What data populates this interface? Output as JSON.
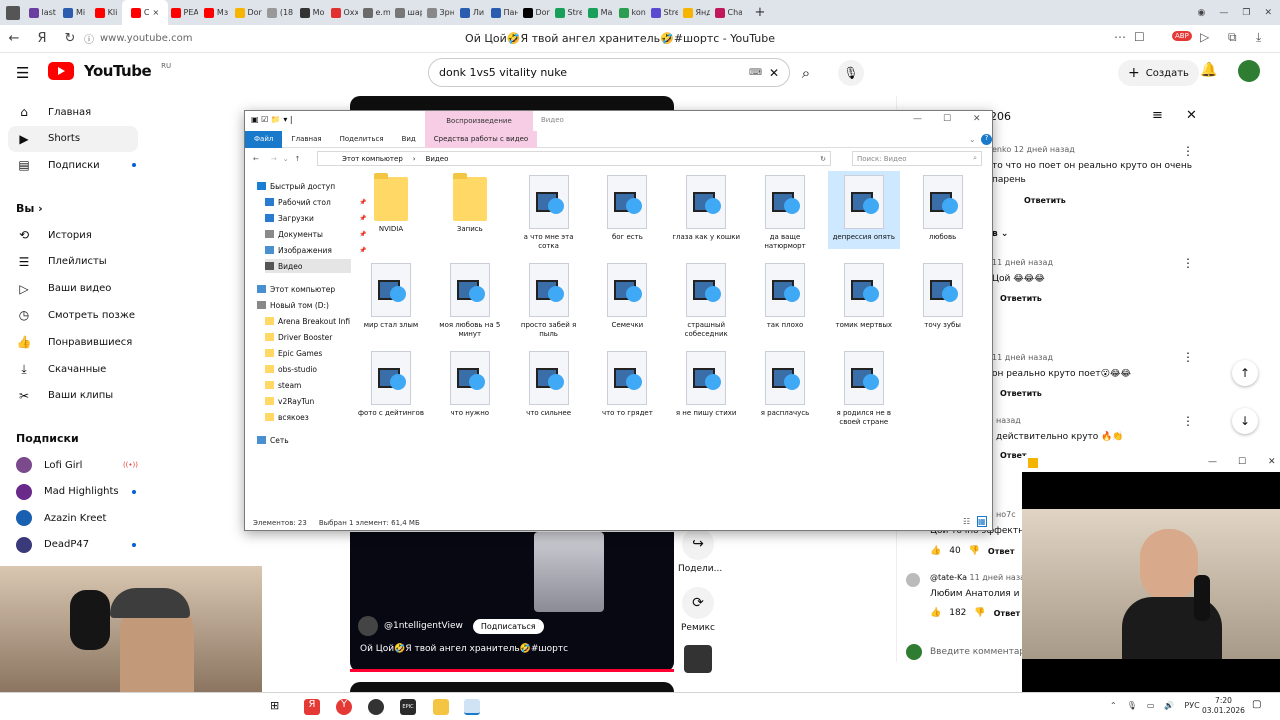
{
  "browser": {
    "tabs": [
      {
        "label": "last",
        "color": "#6b3fa0"
      },
      {
        "label": "Mi",
        "color": "#2a5db0"
      },
      {
        "label": "Kli",
        "color": "#ff0000"
      },
      {
        "label": "C",
        "color": "#ff0000",
        "active": true
      },
      {
        "label": "PEA",
        "color": "#ff0000"
      },
      {
        "label": "Mз",
        "color": "#ff0000"
      },
      {
        "label": "Dor",
        "color": "#f4b400"
      },
      {
        "label": "(18",
        "color": "#999999"
      },
      {
        "label": "Mo",
        "color": "#333333"
      },
      {
        "label": "Oxx",
        "color": "#e03030"
      },
      {
        "label": "e.m",
        "color": "#6a6a6a"
      },
      {
        "label": "шар",
        "color": "#777777"
      },
      {
        "label": "Зрн",
        "color": "#888888"
      },
      {
        "label": "Ли",
        "color": "#2a5db0"
      },
      {
        "label": "Пан",
        "color": "#2a5db0"
      },
      {
        "label": "Dor",
        "color": "#000000"
      },
      {
        "label": "Stre",
        "color": "#18a05a"
      },
      {
        "label": "Ma",
        "color": "#18a05a"
      },
      {
        "label": "kon",
        "color": "#2a9d50"
      },
      {
        "label": "Stre",
        "color": "#5a4ad0"
      },
      {
        "label": "Янд",
        "color": "#f4b400"
      },
      {
        "label": "Cha",
        "color": "#c2185b"
      }
    ],
    "url": "www.youtube.com",
    "page_title": "Ой Цой🤣Я твой ангел хранитель🤣#шортс - YouTube",
    "abp_label": "ABP"
  },
  "youtube": {
    "logo_text": "YouTube",
    "logo_region": "RU",
    "search_value": "donk 1vs5 vitality nuke",
    "create_label": "Создать",
    "nav": [
      {
        "label": "Главная",
        "icon": "home-icon"
      },
      {
        "label": "Shorts",
        "icon": "shorts-icon",
        "selected": true
      },
      {
        "label": "Подписки",
        "icon": "subscriptions-icon",
        "dot": true
      }
    ],
    "you_label": "Вы",
    "you_items": [
      {
        "label": "История",
        "icon": "history-icon"
      },
      {
        "label": "Плейлисты",
        "icon": "playlists-icon"
      },
      {
        "label": "Ваши видео",
        "icon": "your-videos-icon"
      },
      {
        "label": "Смотреть позже",
        "icon": "watch-later-icon"
      },
      {
        "label": "Понравившиеся",
        "icon": "liked-icon"
      },
      {
        "label": "Скачанные",
        "icon": "download-icon"
      },
      {
        "label": "Ваши клипы",
        "icon": "clips-icon"
      }
    ],
    "subs_heading": "Подписки",
    "channels": [
      {
        "label": "Lofi Girl",
        "color": "#7b4a8c",
        "live": true
      },
      {
        "label": "Mad Highlights",
        "color": "#6a2a8a",
        "dot": true
      },
      {
        "label": "Azazin Kreet",
        "color": "#1a60b0"
      },
      {
        "label": "DeadP47",
        "color": "#3a3a7a",
        "dot": true
      }
    ],
    "short": {
      "channel": "@1ntelligentView",
      "subscribe_label": "Подписаться",
      "title": "Ой Цой🤣Я твой ангел хранитель🤣#шортс",
      "share_label": "Подели...",
      "remix_label": "Ремикс"
    },
    "comments": {
      "count_partial": "206",
      "items": [
        {
          "author": "enko",
          "time": "12 дней назад",
          "text1": "то что но поет он реально круто он очень",
          "text2": "парень",
          "reply": "Ответить"
        },
        {
          "section": "в"
        },
        {
          "author": "",
          "time": "11 дней назад",
          "text1": "Цой 😂😂😂",
          "reply": "Ответить"
        },
        {
          "author": "",
          "time": "11 дней назад",
          "text1": "он реально круто поет😮😂😂",
          "reply": "Ответить"
        },
        {
          "author": "",
          "time": "назад",
          "text1": "действительно круто 🔥👏",
          "reply": "Ответ"
        }
      ],
      "partial_author": "но7с",
      "partial_text": "Цой точно эффектно",
      "likes1": "40",
      "reply_short": "Ответ",
      "author2": "@tate-Ka",
      "time2": "11 дней назад",
      "text_last": "Любим Анатолия и",
      "likes2": "182",
      "input_placeholder": "Введите комментари"
    }
  },
  "explorer": {
    "context_tab": "Воспроизведение",
    "window_title": "Видео",
    "ribbon": [
      "Файл",
      "Главная",
      "Поделиться",
      "Вид",
      "Средства работы с видео"
    ],
    "path": [
      "Этот компьютер",
      "Видео"
    ],
    "search_placeholder": "Поиск: Видео",
    "tree": [
      {
        "label": "Быстрый доступ",
        "level": 0,
        "color": "#1a7fd4"
      },
      {
        "label": "Рабочий стол",
        "level": 1,
        "color": "#2a7bd0",
        "pin": true
      },
      {
        "label": "Загрузки",
        "level": 1,
        "color": "#2a7bd0",
        "pin": true
      },
      {
        "label": "Документы",
        "level": 1,
        "color": "#8a8a8a",
        "pin": true
      },
      {
        "label": "Изображения",
        "level": 1,
        "color": "#4a90d0",
        "pin": true
      },
      {
        "label": "Видео",
        "level": 1,
        "color": "#555",
        "selected": true
      },
      {
        "label": "Этот компьютер",
        "level": 0,
        "color": "#4a90d0"
      },
      {
        "label": "Новый том (D:)",
        "level": 0,
        "color": "#888"
      },
      {
        "label": "Arena Breakout Infi",
        "level": 1,
        "color": "#ffd866"
      },
      {
        "label": "Driver Booster",
        "level": 1,
        "color": "#ffd866"
      },
      {
        "label": "Epic Games",
        "level": 1,
        "color": "#ffd866"
      },
      {
        "label": "obs-studio",
        "level": 1,
        "color": "#ffd866"
      },
      {
        "label": "steam",
        "level": 1,
        "color": "#ffd866"
      },
      {
        "label": "v2RayTun",
        "level": 1,
        "color": "#ffd866"
      },
      {
        "label": "всякоез",
        "level": 1,
        "color": "#ffd866"
      },
      {
        "label": "Сеть",
        "level": 0,
        "color": "#4a90d0"
      }
    ],
    "items": [
      {
        "label": "NVIDIA",
        "type": "folder"
      },
      {
        "label": "Запись",
        "type": "folder"
      },
      {
        "label": "а что мне эта сотка",
        "type": "video"
      },
      {
        "label": "бог есть",
        "type": "video"
      },
      {
        "label": "глаза как у кошки",
        "type": "video"
      },
      {
        "label": "да ваще натюрморт",
        "type": "video"
      },
      {
        "label": "депрессия опять",
        "type": "video",
        "selected": true
      },
      {
        "label": "любовь",
        "type": "video"
      },
      {
        "label": "мир стал злым",
        "type": "video"
      },
      {
        "label": "моя любовь на 5 минут",
        "type": "video"
      },
      {
        "label": "просто забей я пыль",
        "type": "video"
      },
      {
        "label": "Семечки",
        "type": "video"
      },
      {
        "label": "страшный собеседник",
        "type": "video"
      },
      {
        "label": "так плохо",
        "type": "video"
      },
      {
        "label": "томик мертвых",
        "type": "video"
      },
      {
        "label": "точу зубы",
        "type": "video"
      },
      {
        "label": "фото с дейтингов",
        "type": "video"
      },
      {
        "label": "что нужно",
        "type": "video"
      },
      {
        "label": "что сильнее",
        "type": "video"
      },
      {
        "label": "что то грядет",
        "type": "video"
      },
      {
        "label": "я не пишу стихи",
        "type": "video"
      },
      {
        "label": "я расплачусь",
        "type": "video"
      },
      {
        "label": "я родился не в своей стране",
        "type": "video"
      }
    ],
    "status_count": "Элементов: 23",
    "status_selected": "Выбран 1 элемент: 61,4 МБ"
  },
  "taskbar": {
    "lang": "РУС",
    "time": "7:20",
    "date": "03.01.2026",
    "epic_label": "EPIC"
  }
}
